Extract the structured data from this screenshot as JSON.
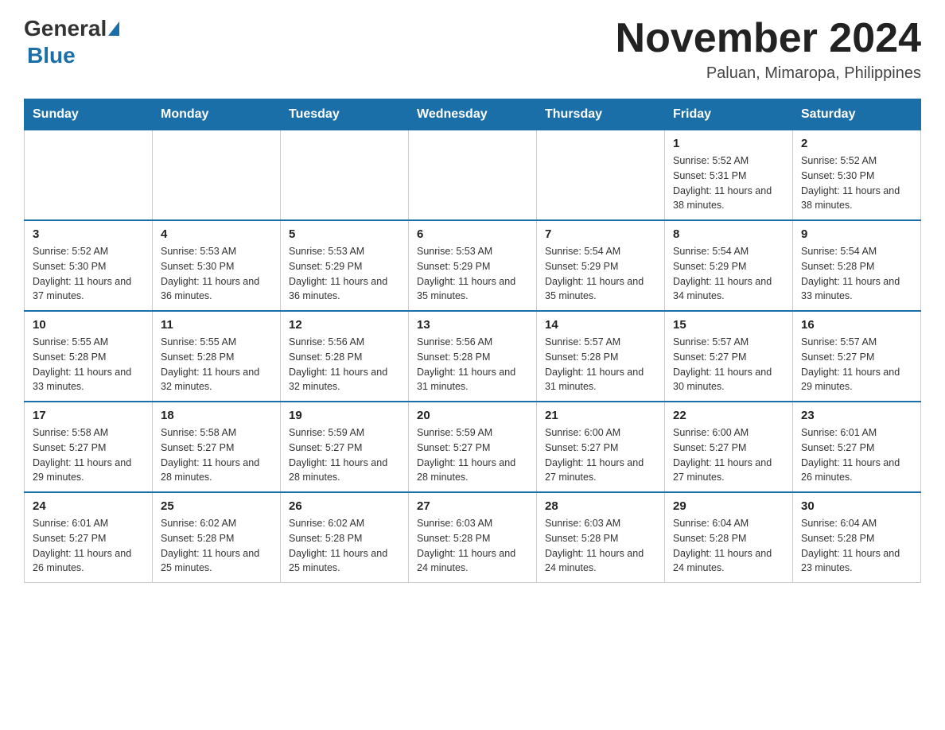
{
  "header": {
    "logo": {
      "general": "General",
      "blue": "Blue"
    },
    "title": "November 2024",
    "location": "Paluan, Mimaropa, Philippines"
  },
  "calendar": {
    "days_of_week": [
      "Sunday",
      "Monday",
      "Tuesday",
      "Wednesday",
      "Thursday",
      "Friday",
      "Saturday"
    ],
    "weeks": [
      [
        {
          "day": "",
          "info": ""
        },
        {
          "day": "",
          "info": ""
        },
        {
          "day": "",
          "info": ""
        },
        {
          "day": "",
          "info": ""
        },
        {
          "day": "",
          "info": ""
        },
        {
          "day": "1",
          "info": "Sunrise: 5:52 AM\nSunset: 5:31 PM\nDaylight: 11 hours and 38 minutes."
        },
        {
          "day": "2",
          "info": "Sunrise: 5:52 AM\nSunset: 5:30 PM\nDaylight: 11 hours and 38 minutes."
        }
      ],
      [
        {
          "day": "3",
          "info": "Sunrise: 5:52 AM\nSunset: 5:30 PM\nDaylight: 11 hours and 37 minutes."
        },
        {
          "day": "4",
          "info": "Sunrise: 5:53 AM\nSunset: 5:30 PM\nDaylight: 11 hours and 36 minutes."
        },
        {
          "day": "5",
          "info": "Sunrise: 5:53 AM\nSunset: 5:29 PM\nDaylight: 11 hours and 36 minutes."
        },
        {
          "day": "6",
          "info": "Sunrise: 5:53 AM\nSunset: 5:29 PM\nDaylight: 11 hours and 35 minutes."
        },
        {
          "day": "7",
          "info": "Sunrise: 5:54 AM\nSunset: 5:29 PM\nDaylight: 11 hours and 35 minutes."
        },
        {
          "day": "8",
          "info": "Sunrise: 5:54 AM\nSunset: 5:29 PM\nDaylight: 11 hours and 34 minutes."
        },
        {
          "day": "9",
          "info": "Sunrise: 5:54 AM\nSunset: 5:28 PM\nDaylight: 11 hours and 33 minutes."
        }
      ],
      [
        {
          "day": "10",
          "info": "Sunrise: 5:55 AM\nSunset: 5:28 PM\nDaylight: 11 hours and 33 minutes."
        },
        {
          "day": "11",
          "info": "Sunrise: 5:55 AM\nSunset: 5:28 PM\nDaylight: 11 hours and 32 minutes."
        },
        {
          "day": "12",
          "info": "Sunrise: 5:56 AM\nSunset: 5:28 PM\nDaylight: 11 hours and 32 minutes."
        },
        {
          "day": "13",
          "info": "Sunrise: 5:56 AM\nSunset: 5:28 PM\nDaylight: 11 hours and 31 minutes."
        },
        {
          "day": "14",
          "info": "Sunrise: 5:57 AM\nSunset: 5:28 PM\nDaylight: 11 hours and 31 minutes."
        },
        {
          "day": "15",
          "info": "Sunrise: 5:57 AM\nSunset: 5:27 PM\nDaylight: 11 hours and 30 minutes."
        },
        {
          "day": "16",
          "info": "Sunrise: 5:57 AM\nSunset: 5:27 PM\nDaylight: 11 hours and 29 minutes."
        }
      ],
      [
        {
          "day": "17",
          "info": "Sunrise: 5:58 AM\nSunset: 5:27 PM\nDaylight: 11 hours and 29 minutes."
        },
        {
          "day": "18",
          "info": "Sunrise: 5:58 AM\nSunset: 5:27 PM\nDaylight: 11 hours and 28 minutes."
        },
        {
          "day": "19",
          "info": "Sunrise: 5:59 AM\nSunset: 5:27 PM\nDaylight: 11 hours and 28 minutes."
        },
        {
          "day": "20",
          "info": "Sunrise: 5:59 AM\nSunset: 5:27 PM\nDaylight: 11 hours and 28 minutes."
        },
        {
          "day": "21",
          "info": "Sunrise: 6:00 AM\nSunset: 5:27 PM\nDaylight: 11 hours and 27 minutes."
        },
        {
          "day": "22",
          "info": "Sunrise: 6:00 AM\nSunset: 5:27 PM\nDaylight: 11 hours and 27 minutes."
        },
        {
          "day": "23",
          "info": "Sunrise: 6:01 AM\nSunset: 5:27 PM\nDaylight: 11 hours and 26 minutes."
        }
      ],
      [
        {
          "day": "24",
          "info": "Sunrise: 6:01 AM\nSunset: 5:27 PM\nDaylight: 11 hours and 26 minutes."
        },
        {
          "day": "25",
          "info": "Sunrise: 6:02 AM\nSunset: 5:28 PM\nDaylight: 11 hours and 25 minutes."
        },
        {
          "day": "26",
          "info": "Sunrise: 6:02 AM\nSunset: 5:28 PM\nDaylight: 11 hours and 25 minutes."
        },
        {
          "day": "27",
          "info": "Sunrise: 6:03 AM\nSunset: 5:28 PM\nDaylight: 11 hours and 24 minutes."
        },
        {
          "day": "28",
          "info": "Sunrise: 6:03 AM\nSunset: 5:28 PM\nDaylight: 11 hours and 24 minutes."
        },
        {
          "day": "29",
          "info": "Sunrise: 6:04 AM\nSunset: 5:28 PM\nDaylight: 11 hours and 24 minutes."
        },
        {
          "day": "30",
          "info": "Sunrise: 6:04 AM\nSunset: 5:28 PM\nDaylight: 11 hours and 23 minutes."
        }
      ]
    ]
  }
}
